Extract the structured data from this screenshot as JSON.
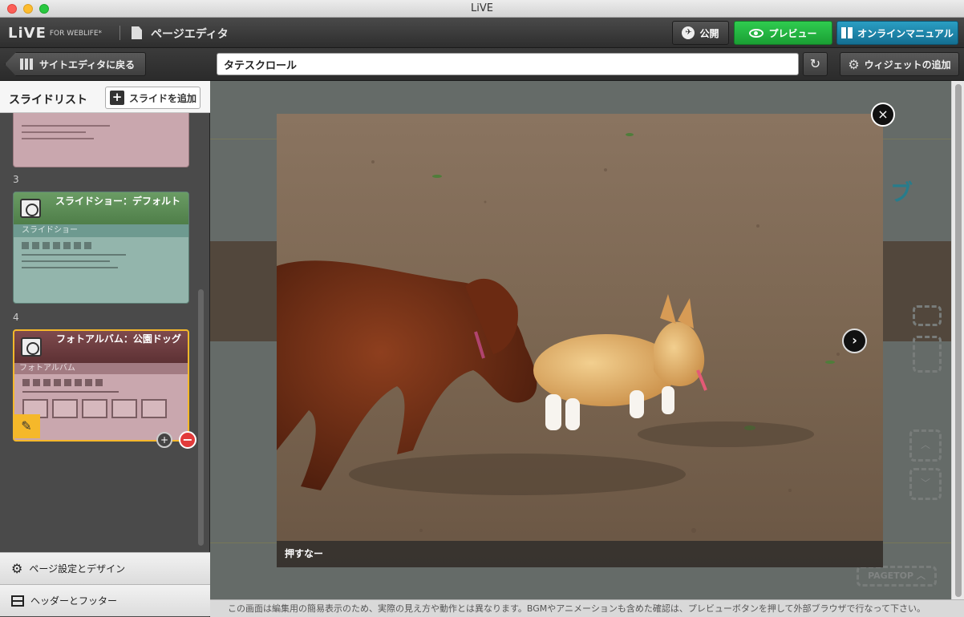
{
  "window": {
    "title": "LiVE"
  },
  "appbar": {
    "logo_main": "LiVE",
    "logo_sub": "FOR WEBLIFE*",
    "page_title": "ページエディタ",
    "publish_label": "公開",
    "preview_label": "プレビュー",
    "manual_label": "オンラインマニュアル"
  },
  "toolbar": {
    "back_label": "サイトエディタに戻る",
    "page_title_value": "タテスクロール",
    "widget_label": "ウィジェットの追加"
  },
  "sidebar": {
    "title": "スライドリスト",
    "add_slide_label": "スライドを追加",
    "slides": [
      {
        "number": "3",
        "title": "スライドショー：デフォルト",
        "subtitle": "スライドショー"
      },
      {
        "number": "4",
        "title": "フォトアルバム：公園ドッグ",
        "subtitle": "フォトアルバム"
      }
    ],
    "page_settings_label": "ページ設定とデザイン",
    "header_footer_label": "ヘッダーとフッター"
  },
  "lightbox": {
    "caption": "押すなー",
    "close_glyph": "×",
    "next_glyph": "›"
  },
  "preview_bg": {
    "pagetop_label": "PAGETOP"
  },
  "status": {
    "message": "この画面は編集用の簡易表示のため、実際の見え方や動作とは異なります。BGMやアニメーションも含めた確認は、プレビューボタンを押して外部ブラウザで行なって下さい。"
  },
  "colors": {
    "preview_green": "#1a9f34",
    "manual_blue": "#146f92",
    "selected_outline": "#f5b82a",
    "remove_red": "#e23b3b"
  }
}
